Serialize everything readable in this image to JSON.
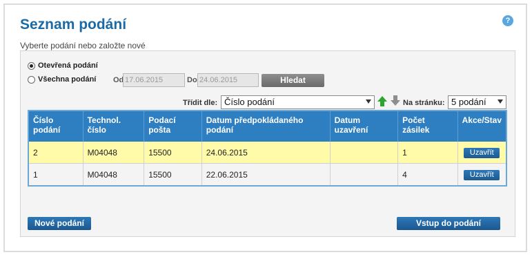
{
  "page": {
    "title": "Seznam podání",
    "subtitle": "Vyberte podání nebo založte nové",
    "help_label": "?"
  },
  "filter": {
    "radio_open": "Otevřená podání",
    "radio_all": "Všechna podání",
    "from_label": "Od",
    "from_value": "17.06.2015",
    "to_label": "Do",
    "to_value": "24.06.2015",
    "search_button": "Hledat",
    "selected_radio": "open"
  },
  "sort": {
    "label": "Třídit dle:",
    "value": "Číslo podání",
    "per_page_label": "Na stránku:",
    "per_page_value": "5 podání"
  },
  "table": {
    "headers": [
      "Číslo podání",
      "Technol. číslo",
      "Podací pošta",
      "Datum předpokládaného podání",
      "Datum uzavření",
      "Počet zásilek",
      "Akce/Stav"
    ],
    "rows": [
      {
        "cislo": "2",
        "technol": "M04048",
        "posta": "15500",
        "datum_pred": "24.06.2015",
        "datum_uz": "",
        "pocet": "1",
        "akce": "Uzavřít"
      },
      {
        "cislo": "1",
        "technol": "M04048",
        "posta": "15500",
        "datum_pred": "22.06.2015",
        "datum_uz": "",
        "pocet": "4",
        "akce": "Uzavřít"
      }
    ]
  },
  "footer": {
    "new_button": "Nové podání",
    "enter_button": "Vstup do podání"
  },
  "colors": {
    "title": "#1b6aa5",
    "header": "#2e7fc2",
    "highlight_row": "#fffba8",
    "button_blue": "#1c5a91"
  }
}
